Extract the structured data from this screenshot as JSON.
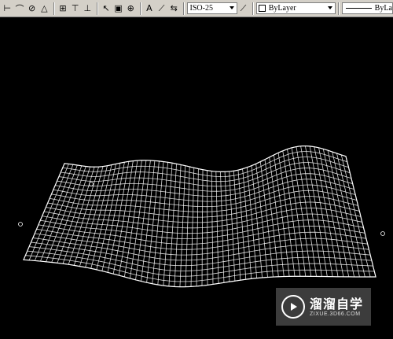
{
  "toolbar": {
    "dimstyle_value": "ISO-25",
    "layer_value": "ByLayer",
    "linetype_value": "ByLa"
  },
  "watermark": {
    "brand": "溜溜自学",
    "url": "ZIXUE.3D66.COM"
  },
  "colors": {
    "background": "#000000",
    "mesh": "#ffffff",
    "toolbar": "#d4d0c8"
  }
}
